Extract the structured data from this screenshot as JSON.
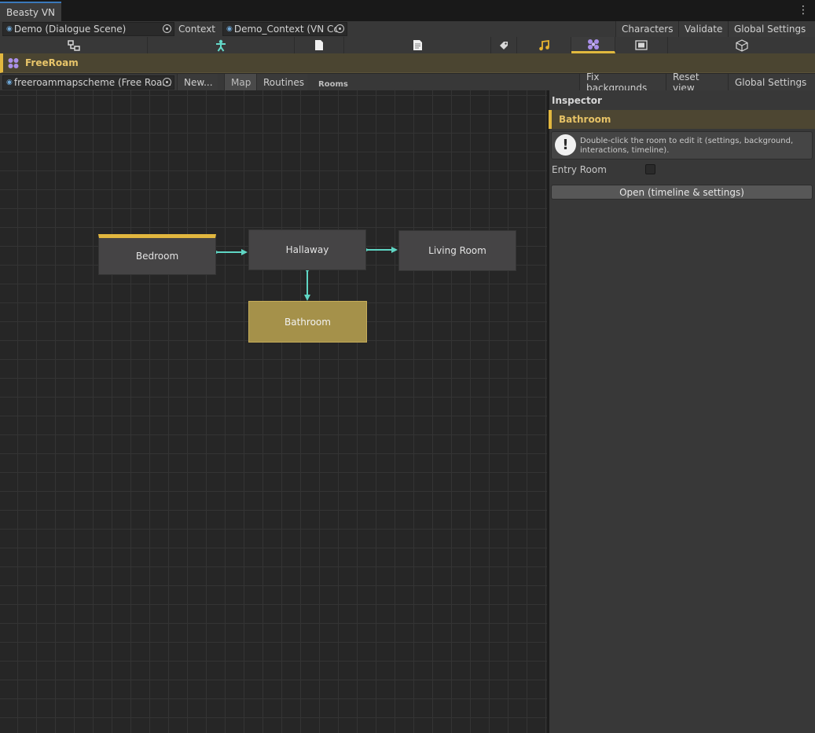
{
  "window": {
    "tab_title": "Beasty VN"
  },
  "context_bar": {
    "scene_field": "Demo (Dialogue Scene)",
    "context_label": "Context",
    "context_field": "Demo_Context (VN Cc",
    "characters_btn": "Characters",
    "validate_btn": "Validate",
    "global_settings_btn": "Global Settings"
  },
  "icon_tabs": [
    "flow-icon",
    "character-icon",
    "page-icon",
    "document-icon",
    "tag-icon",
    "music-icon",
    "freeroam-icon",
    "frame-icon",
    "cube-icon"
  ],
  "colors": {
    "accent": "#e2b73f",
    "arrow": "#5fd6c4",
    "freeroam_icon": "#a98fe8",
    "music_icon": "#e8b330",
    "character_icon": "#64d8c8"
  },
  "header": {
    "title": "FreeRoam"
  },
  "map_toolbar": {
    "scheme_field": "freeroammapscheme (Free Roam",
    "new_btn": "New...",
    "map_btn": "Map",
    "routines_btn": "Routines",
    "rooms_label": "Rooms",
    "fix_backgrounds_btn": "Fix backgrounds",
    "reset_view_btn": "Reset view",
    "global_settings_btn": "Global Settings"
  },
  "map": {
    "rooms": [
      {
        "name": "Bedroom",
        "entry": true,
        "selected": false
      },
      {
        "name": "Hallaway",
        "entry": false,
        "selected": false
      },
      {
        "name": "Living Room",
        "entry": false,
        "selected": false
      },
      {
        "name": "Bathroom",
        "entry": false,
        "selected": true
      }
    ],
    "connections": [
      [
        "Bedroom",
        "Hallaway"
      ],
      [
        "Hallaway",
        "Living Room"
      ],
      [
        "Hallaway",
        "Bathroom"
      ]
    ]
  },
  "inspector": {
    "title": "Inspector",
    "selected_room": "Bathroom",
    "help_text": "Double-click the room to edit it (settings, background, interactions, timeline).",
    "entry_room_label": "Entry Room",
    "entry_room_checked": false,
    "open_btn": "Open (timeline & settings)"
  }
}
